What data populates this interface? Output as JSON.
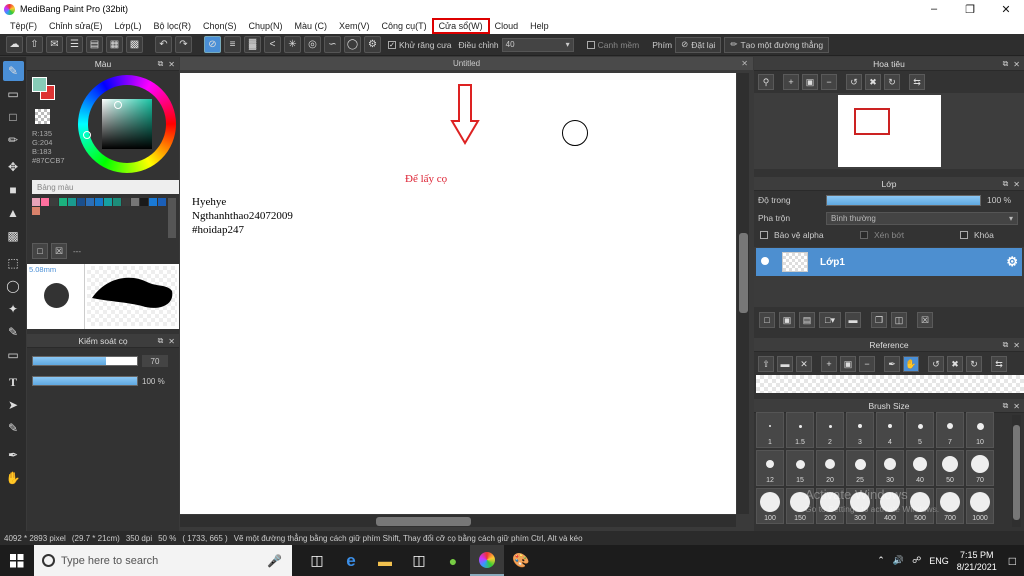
{
  "window": {
    "title": "MediBang Paint Pro (32bit)"
  },
  "menu": [
    {
      "label": "Tệp(F)"
    },
    {
      "label": "Chỉnh sửa(E)"
    },
    {
      "label": "Lớp(L)"
    },
    {
      "label": "Bộ lọc(R)"
    },
    {
      "label": "Chọn(S)"
    },
    {
      "label": "Chụp(N)"
    },
    {
      "label": "Màu (C)"
    },
    {
      "label": "Xem(V)"
    },
    {
      "label": "Công cụ(T)"
    },
    {
      "label": "Cửa sổ(W)",
      "highlighted": true
    },
    {
      "label": "Cloud"
    },
    {
      "label": "Help"
    }
  ],
  "toolbar": {
    "antialias_label": "Khử răng cưa",
    "correction_label": "Điều chỉnh",
    "correction_value": "40",
    "canh_mem_label": "Canh mềm",
    "phim_label": "Phím",
    "reset_label": "Đặt lại",
    "straight_line_label": "Tạo một đường thẳng"
  },
  "color_panel": {
    "title": "Màu",
    "r": "R:135",
    "g": "G:204",
    "b": "B:183",
    "hex": "#87CCB7",
    "palette_label": "Bảng màu",
    "palette_swatches": [
      "#e8a3b8",
      "#ff6f9e",
      "#3c3c3c",
      "#1bb27e",
      "#1a9a8f",
      "#1b4f8c",
      "#2b6fb8",
      "#1778c9",
      "#16a0a0",
      "#1d8d7a",
      "#3a3a3a",
      "#777777",
      "#1a1a1a",
      "#1a7ad6",
      "#1b5fb8",
      "#d9826b"
    ],
    "palette_extra": "---"
  },
  "brush_panel": {
    "size_label": "5.08mm"
  },
  "brush_control": {
    "title": "Kiểm soát cọ",
    "size_value": "70",
    "size_fill": 0.7,
    "opacity_value": "100 %",
    "opacity_fill": 1.0
  },
  "document": {
    "tab_title": "Untitled"
  },
  "canvas": {
    "lines": [
      "Hyehye",
      "Ngthanhthao24072009",
      "#hoidap247"
    ],
    "annotation": "Để lấy cọ"
  },
  "navigator": {
    "title": "Hoa tiêu"
  },
  "layer_panel": {
    "title": "Lớp",
    "opacity_label": "Độ trong",
    "opacity_value": "100 %",
    "blend_label": "Pha trộn",
    "blend_value": "Bình thường",
    "protect_alpha": "Bảo vệ alpha",
    "clipping": "Xén bớt",
    "lock": "Khóa",
    "layer_name": "Lớp1"
  },
  "reference": {
    "title": "Reference"
  },
  "brush_size": {
    "title": "Brush Size",
    "sizes": [
      "1",
      "1.5",
      "2",
      "3",
      "4",
      "5",
      "7",
      "10",
      "12",
      "15",
      "20",
      "25",
      "30",
      "40",
      "50",
      "70",
      "100",
      "150",
      "200",
      "300",
      "400",
      "500",
      "700",
      "1000"
    ]
  },
  "status": {
    "size": "4092 * 2893 pixel",
    "cm": "(29.7 * 21cm)",
    "dpi": "350 dpi",
    "zoom": "50 %",
    "coords": "( 1733, 665 )",
    "hint": "Vẽ một đường thẳng bằng cách giữ phím Shift, Thay đổi cỡ cọ bằng cách giữ phím Ctrl, Alt và kéo"
  },
  "taskbar": {
    "search_placeholder": "Type here to search",
    "lang": "ENG",
    "time": "7:15 PM",
    "date": "8/21/2021"
  },
  "watermark": {
    "line1": "Activate Windows",
    "line2": "Go to Settings to activate Windows."
  }
}
